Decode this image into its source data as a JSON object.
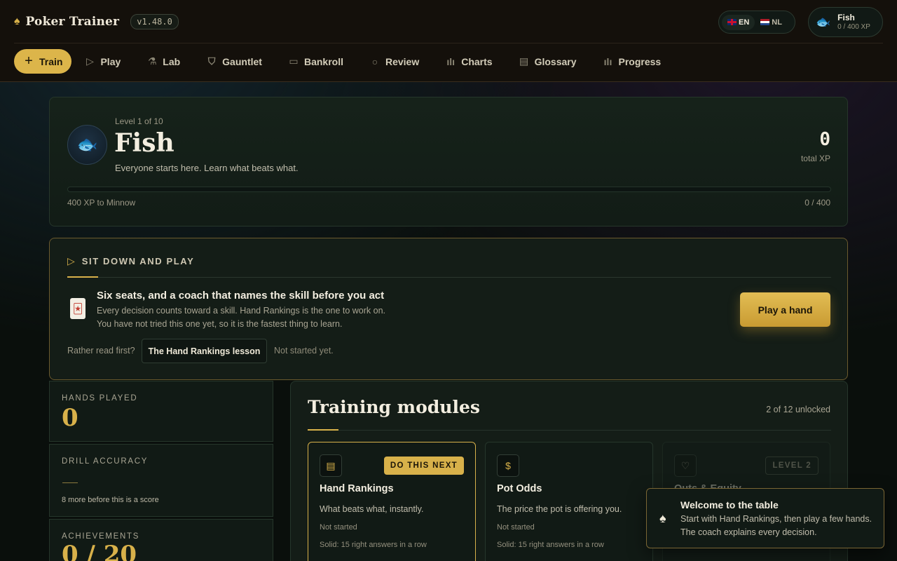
{
  "app": {
    "name": "Poker Trainer",
    "version": "v1.48.0"
  },
  "lang": {
    "en": "EN",
    "nl": "NL"
  },
  "user": {
    "name": "Fish",
    "xp": "0 / 400 XP"
  },
  "nav": [
    {
      "label": "Train",
      "icon": "plus-icon",
      "active": true
    },
    {
      "label": "Play",
      "icon": "play-icon"
    },
    {
      "label": "Lab",
      "icon": "flask-icon"
    },
    {
      "label": "Gauntlet",
      "icon": "shield-icon"
    },
    {
      "label": "Bankroll",
      "icon": "wallet-icon"
    },
    {
      "label": "Review",
      "icon": "search-icon"
    },
    {
      "label": "Charts",
      "icon": "bar-chart-icon"
    },
    {
      "label": "Glossary",
      "icon": "book-icon"
    },
    {
      "label": "Progress",
      "icon": "bar-chart-icon"
    }
  ],
  "level": {
    "sub": "Level 1 of 10",
    "title": "Fish",
    "desc": "Everyone starts here. Learn what beats what.",
    "total_xp": "0",
    "total_xp_label": "total XP",
    "progress_fraction": 0,
    "to_next": "400 XP to Minnow",
    "count": "0 / 400"
  },
  "sit": {
    "heading": "SIT DOWN AND PLAY",
    "title": "Six seats, and a coach that names the skill before you act",
    "line1": "Every decision counts toward a skill. Hand Rankings is the one to work on.",
    "line2": "You have not tried this one yet, so it is the fastest thing to learn.",
    "play_label": "Play a hand",
    "read_first": "Rather read first?",
    "lesson_label": "The Hand Rankings lesson",
    "lesson_status": "Not started yet."
  },
  "stats": {
    "hands_label": "HANDS PLAYED",
    "hands_value": "0",
    "accuracy_label": "DRILL ACCURACY",
    "accuracy_note": "8 more before this is a score",
    "achievements_label": "ACHIEVEMENTS",
    "achievements_value": "0 / 20"
  },
  "modules": {
    "title": "Training modules",
    "count": "2 of 12 unlocked",
    "items": [
      {
        "title": "Hand Rankings",
        "desc": "What beats what, instantly.",
        "status": "Not started",
        "goal": "Solid: 15 right answers in a row",
        "badge": "DO THIS NEXT",
        "icon": "list-icon"
      },
      {
        "title": "Pot Odds",
        "desc": "The price the pot is offering you.",
        "status": "Not started",
        "goal": "Solid: 15 right answers in a row",
        "icon": "dollar-icon"
      },
      {
        "title": "Outs & Equity",
        "badge": "LEVEL 2",
        "icon": "heart-icon"
      }
    ]
  },
  "toast": {
    "title": "Welcome to the table",
    "body": "Start with Hand Rankings, then play a few hands. The coach explains every decision."
  },
  "colors": {
    "accent": "#d8b14a",
    "bg": "#0a0f0c",
    "card": "#131d17"
  }
}
